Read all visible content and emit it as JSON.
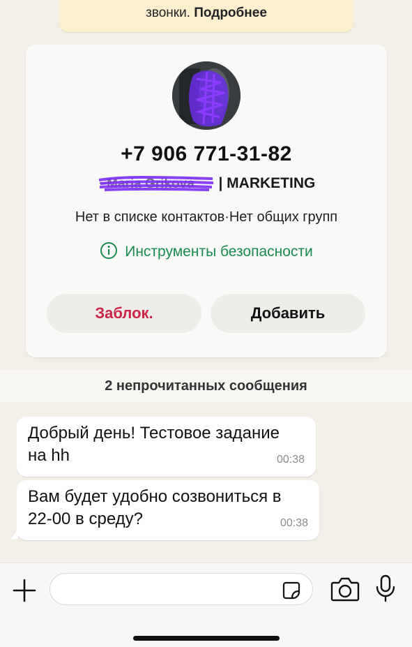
{
  "notice": {
    "text": "звонки. ",
    "link": "Подробнее"
  },
  "contact": {
    "phone": "+7 906 771-31-82",
    "name_suffix": " | MARKETING",
    "status": "Нет в списке контактов·Нет общих групп",
    "safety_tools": "Инструменты безопасности",
    "block_label": "Заблок.",
    "add_label": "Добавить"
  },
  "unread_banner": "2 непрочитанных сообщения",
  "messages": [
    {
      "text_line1": "Добрый день! Тестовое задание",
      "text_line2": "на hh",
      "time": "00:38"
    },
    {
      "text_line1": "Вам будет удобно созвониться в",
      "text_line2": "22-00 в среду?",
      "time": "00:38"
    }
  ],
  "colors": {
    "background": "#f2efe8",
    "accent_green": "#1a8a4f",
    "block_red": "#cc2547",
    "scribble_purple": "#7b2cf5"
  }
}
